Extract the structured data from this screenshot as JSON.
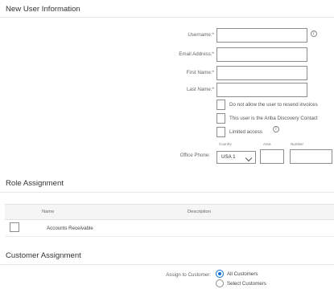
{
  "sections": {
    "user_info": "New User Information",
    "role_assignment": "Role Assignment",
    "customer_assignment": "Customer Assignment"
  },
  "fields": {
    "username": {
      "label": "Username:",
      "value": ""
    },
    "email": {
      "label": "Email Address:",
      "value": ""
    },
    "first_name": {
      "label": "First Name:",
      "value": ""
    },
    "last_name": {
      "label": "Last Name:",
      "value": ""
    },
    "required_mark": "*"
  },
  "checkboxes": {
    "no_resend": "Do not allow the user to resend invoices",
    "discovery_contact": "This user is the Ariba Discovery Contact",
    "limited_access": "Limited access"
  },
  "office_phone": {
    "label": "Office Phone:",
    "country_label": "Country",
    "area_label": "Area",
    "number_label": "Number",
    "country_value": "USA 1",
    "area_value": "",
    "number_value": ""
  },
  "role_table": {
    "headers": {
      "name": "Name",
      "description": "Description"
    },
    "rows": [
      {
        "name": "Accounts Receivable",
        "description": ""
      }
    ]
  },
  "customer_assignment": {
    "label": "Assign to Customer:",
    "options": [
      "All Customers",
      "Select Customers"
    ],
    "selected": "All Customers"
  },
  "colors": {
    "accent": "#0a6ed1",
    "border": "#8c8c8c"
  }
}
